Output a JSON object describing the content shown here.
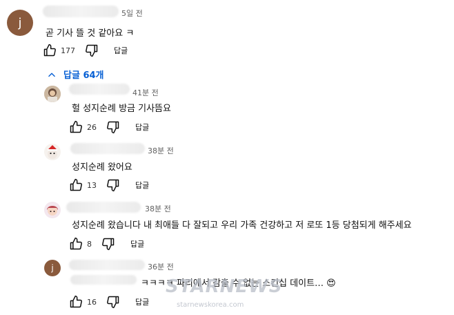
{
  "comment": {
    "avatar_letter": "j",
    "time": "5일 전",
    "text": "곧 기사 뜰 것 같아요 ㅋ",
    "likes": "177",
    "reply_label": "답글"
  },
  "replies_toggle": {
    "label": "답글 64개"
  },
  "replies": [
    {
      "time": "41분 전",
      "text": "헐 성지순례 방금 기사뜸요",
      "likes": "26",
      "reply_label": "답글"
    },
    {
      "time": "38분 전",
      "text": "성지순례 왔어요",
      "likes": "13",
      "reply_label": "답글"
    },
    {
      "time": "38분 전",
      "text": "성지순례 왔습니다 내 최애들 다 잘되고 우리 가족 건강하고 저 로또 1등 당첨되게 해주세요",
      "likes": "8",
      "reply_label": "답글"
    },
    {
      "avatar_letter": "j",
      "time": "36분 전",
      "text": "ㅋㅋㅋㅋ 파리에서 감출 수 없는 스킨십 데이트… 😍",
      "likes": "16",
      "reply_label": "답글"
    }
  ],
  "watermark": {
    "brand": "STARNEWS",
    "url": "starnewskorea.com"
  },
  "colors": {
    "link_blue": "#065fd4",
    "avatar_brown": "#8a5a3c"
  }
}
